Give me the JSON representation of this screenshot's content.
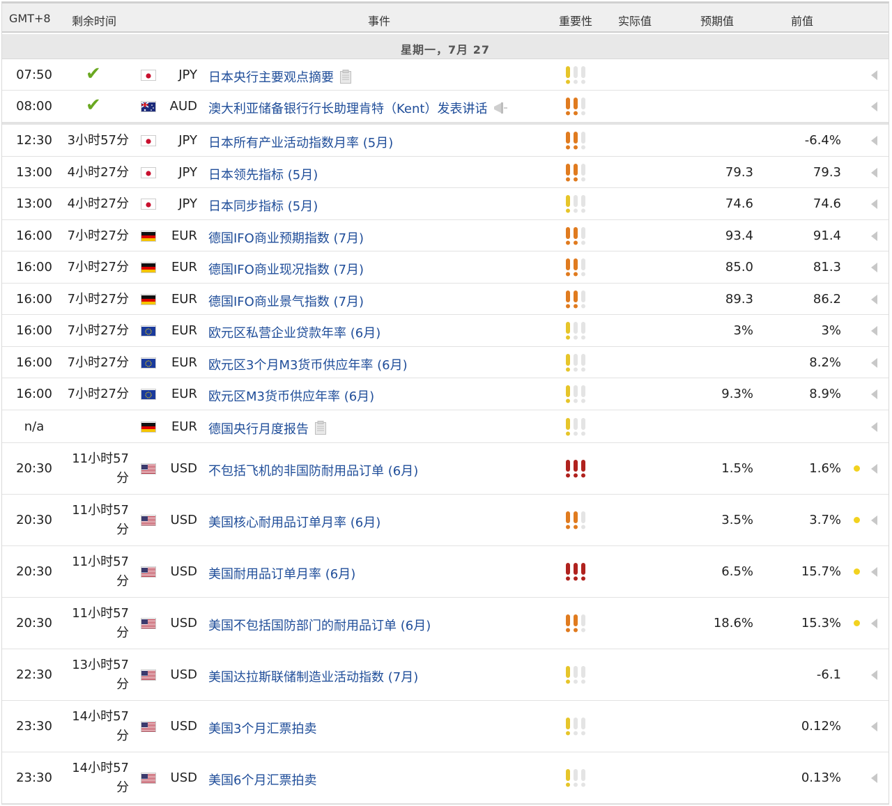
{
  "header": {
    "timezone": "GMT+8",
    "remaining": "剩余时间",
    "event": "事件",
    "importance": "重要性",
    "actual": "实际值",
    "forecast": "预期值",
    "previous": "前值"
  },
  "day_label": "星期一，7月 27",
  "colors": {
    "event_link": "#1f4d99",
    "importance_low": "#e6c52a",
    "importance_medium": "#e07b1f",
    "importance_high": "#b0221e",
    "importance_off": "#e4e4e4",
    "check": "#6aa821",
    "bullish_dot": "#f2d21f"
  },
  "rows": [
    {
      "time": "07:50",
      "remaining": "",
      "released": true,
      "flag": "jp",
      "currency": "JPY",
      "event": "日本央行主要观点摘要",
      "event_icon": "document-icon",
      "importance": 1,
      "actual": "",
      "forecast": "",
      "previous": "",
      "dot": false
    },
    {
      "time": "08:00",
      "remaining": "",
      "released": true,
      "flag": "au",
      "currency": "AUD",
      "event": "澳大利亚储备银行行长助理肯特（Kent）发表讲话",
      "event_icon": "speech-icon",
      "importance": 2,
      "actual": "",
      "forecast": "",
      "previous": "",
      "dot": false
    },
    {
      "time": "12:30",
      "remaining": "3小时57分",
      "released": false,
      "flag": "jp",
      "currency": "JPY",
      "event": "日本所有产业活动指数月率 (5月)",
      "event_icon": "",
      "importance": 2,
      "actual": "",
      "forecast": "",
      "previous": "-6.4%",
      "dot": false
    },
    {
      "time": "13:00",
      "remaining": "4小时27分",
      "released": false,
      "flag": "jp",
      "currency": "JPY",
      "event": "日本领先指标 (5月)",
      "event_icon": "",
      "importance": 2,
      "actual": "",
      "forecast": "79.3",
      "previous": "79.3",
      "dot": false
    },
    {
      "time": "13:00",
      "remaining": "4小时27分",
      "released": false,
      "flag": "jp",
      "currency": "JPY",
      "event": "日本同步指标 (5月)",
      "event_icon": "",
      "importance": 1,
      "actual": "",
      "forecast": "74.6",
      "previous": "74.6",
      "dot": false
    },
    {
      "time": "16:00",
      "remaining": "7小时27分",
      "released": false,
      "flag": "de",
      "currency": "EUR",
      "event": "德国IFO商业预期指数 (7月)",
      "event_icon": "",
      "importance": 2,
      "actual": "",
      "forecast": "93.4",
      "previous": "91.4",
      "dot": false
    },
    {
      "time": "16:00",
      "remaining": "7小时27分",
      "released": false,
      "flag": "de",
      "currency": "EUR",
      "event": "德国IFO商业现况指数 (7月)",
      "event_icon": "",
      "importance": 2,
      "actual": "",
      "forecast": "85.0",
      "previous": "81.3",
      "dot": false
    },
    {
      "time": "16:00",
      "remaining": "7小时27分",
      "released": false,
      "flag": "de",
      "currency": "EUR",
      "event": "德国IFO商业景气指数 (7月)",
      "event_icon": "",
      "importance": 2,
      "actual": "",
      "forecast": "89.3",
      "previous": "86.2",
      "dot": false
    },
    {
      "time": "16:00",
      "remaining": "7小时27分",
      "released": false,
      "flag": "eu",
      "currency": "EUR",
      "event": "欧元区私营企业贷款年率 (6月)",
      "event_icon": "",
      "importance": 1,
      "actual": "",
      "forecast": "3%",
      "previous": "3%",
      "dot": false
    },
    {
      "time": "16:00",
      "remaining": "7小时27分",
      "released": false,
      "flag": "eu",
      "currency": "EUR",
      "event": "欧元区3个月M3货币供应年率 (6月)",
      "event_icon": "",
      "importance": 1,
      "actual": "",
      "forecast": "",
      "previous": "8.2%",
      "dot": false
    },
    {
      "time": "16:00",
      "remaining": "7小时27分",
      "released": false,
      "flag": "eu",
      "currency": "EUR",
      "event": "欧元区M3货币供应年率 (6月)",
      "event_icon": "",
      "importance": 1,
      "actual": "",
      "forecast": "9.3%",
      "previous": "8.9%",
      "dot": false
    },
    {
      "time": "n/a",
      "remaining": "",
      "released": false,
      "flag": "de",
      "currency": "EUR",
      "event": "德国央行月度报告",
      "event_icon": "document-icon",
      "importance": 1,
      "actual": "",
      "forecast": "",
      "previous": "",
      "dot": false
    },
    {
      "time": "20:30",
      "remaining": "11小时57分",
      "released": false,
      "flag": "us",
      "currency": "USD",
      "event": "不包括飞机的非国防耐用品订单 (6月)",
      "event_icon": "",
      "importance": 3,
      "actual": "",
      "forecast": "1.5%",
      "previous": "1.6%",
      "dot": true
    },
    {
      "time": "20:30",
      "remaining": "11小时57分",
      "released": false,
      "flag": "us",
      "currency": "USD",
      "event": "美国核心耐用品订单月率 (6月)",
      "event_icon": "",
      "importance": 2,
      "actual": "",
      "forecast": "3.5%",
      "previous": "3.7%",
      "dot": true
    },
    {
      "time": "20:30",
      "remaining": "11小时57分",
      "released": false,
      "flag": "us",
      "currency": "USD",
      "event": "美国耐用品订单月率 (6月)",
      "event_icon": "",
      "importance": 3,
      "actual": "",
      "forecast": "6.5%",
      "previous": "15.7%",
      "dot": true
    },
    {
      "time": "20:30",
      "remaining": "11小时57分",
      "released": false,
      "flag": "us",
      "currency": "USD",
      "event": "美国不包括国防部门的耐用品订单 (6月)",
      "event_icon": "",
      "importance": 2,
      "actual": "",
      "forecast": "18.6%",
      "previous": "15.3%",
      "dot": true
    },
    {
      "time": "22:30",
      "remaining": "13小时57分",
      "released": false,
      "flag": "us",
      "currency": "USD",
      "event": "美国达拉斯联储制造业活动指数 (7月)",
      "event_icon": "",
      "importance": 1,
      "actual": "",
      "forecast": "",
      "previous": "-6.1",
      "dot": false
    },
    {
      "time": "23:30",
      "remaining": "14小时57分",
      "released": false,
      "flag": "us",
      "currency": "USD",
      "event": "美国3个月汇票拍卖",
      "event_icon": "",
      "importance": 1,
      "actual": "",
      "forecast": "",
      "previous": "0.12%",
      "dot": false
    },
    {
      "time": "23:30",
      "remaining": "14小时57分",
      "released": false,
      "flag": "us",
      "currency": "USD",
      "event": "美国6个月汇票拍卖",
      "event_icon": "",
      "importance": 1,
      "actual": "",
      "forecast": "",
      "previous": "0.13%",
      "dot": false
    }
  ]
}
